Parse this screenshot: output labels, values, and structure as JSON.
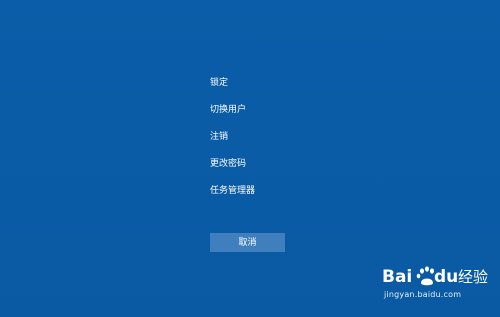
{
  "menu": {
    "items": [
      {
        "label": "锁定"
      },
      {
        "label": "切换用户"
      },
      {
        "label": "注销"
      },
      {
        "label": "更改密码"
      },
      {
        "label": "任务管理器"
      }
    ]
  },
  "cancel_label": "取消",
  "watermark": {
    "brand": "Baidu经验",
    "url": "jingyan.baidu.com"
  },
  "colors": {
    "background": "#0a5ba6",
    "button": "#3f7fbd",
    "text": "#ffffff"
  }
}
